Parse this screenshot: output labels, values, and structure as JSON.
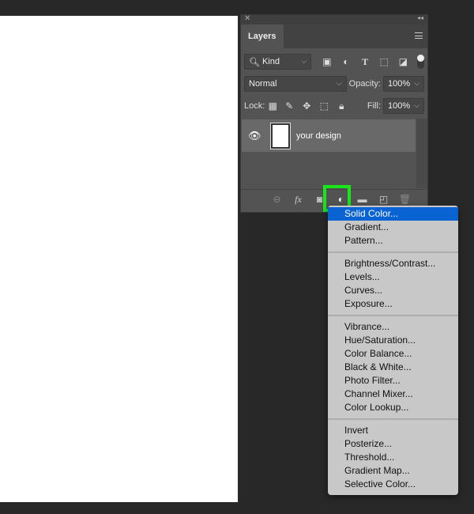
{
  "panel": {
    "tab": "Layers",
    "filter": {
      "label": "Kind"
    },
    "blend_mode": "Normal",
    "opacity_label": "Opacity:",
    "opacity": "100%",
    "lock_label": "Lock:",
    "fill_label": "Fill:",
    "fill": "100%",
    "layers": [
      {
        "name": "your design",
        "visible": true
      }
    ]
  },
  "menu": {
    "groups": [
      [
        "Solid Color...",
        "Gradient...",
        "Pattern..."
      ],
      [
        "Brightness/Contrast...",
        "Levels...",
        "Curves...",
        "Exposure..."
      ],
      [
        "Vibrance...",
        "Hue/Saturation...",
        "Color Balance...",
        "Black & White...",
        "Photo Filter...",
        "Channel Mixer...",
        "Color Lookup..."
      ],
      [
        "Invert",
        "Posterize...",
        "Threshold...",
        "Gradient Map...",
        "Selective Color..."
      ]
    ],
    "highlighted": "Solid Color...",
    "highlight_color": "#0a63d2"
  },
  "highlight_box_color": "#19e619"
}
